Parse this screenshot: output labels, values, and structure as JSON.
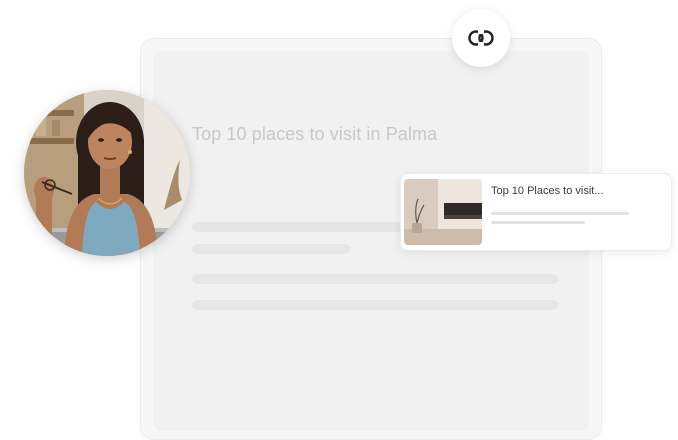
{
  "document": {
    "title": "Top 10 places to visit in Palma"
  },
  "link_badge": {
    "icon": "link-icon"
  },
  "avatar": {
    "icon": "user-photo"
  },
  "link_preview": {
    "title": "Top 10 Places to visit...",
    "thumbnail": "room-interior-thumbnail"
  },
  "colors": {
    "background": "#ffffff",
    "card": "#f7f7f7",
    "placeholder_line": "#e6e6e6",
    "title_faded": "#c8c8c8",
    "preview_text": "#3a3a3a"
  }
}
